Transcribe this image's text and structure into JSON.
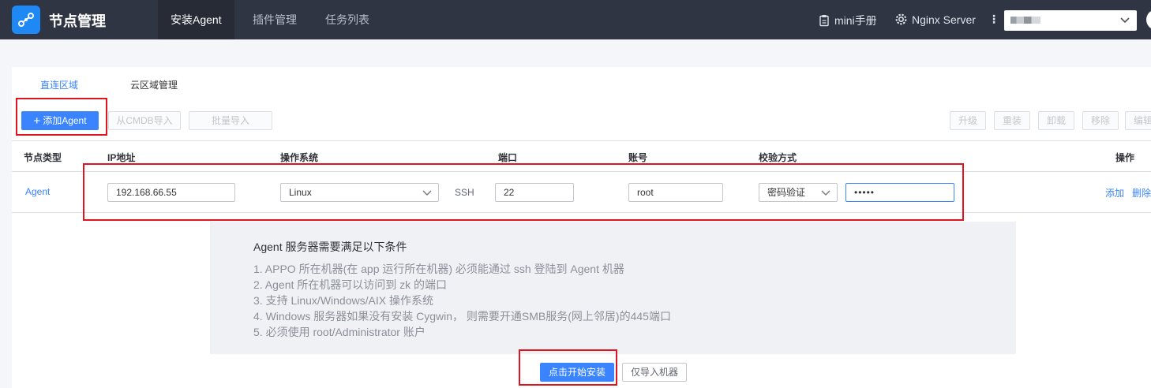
{
  "header": {
    "app_title": "节点管理",
    "tabs": [
      "安装Agent",
      "插件管理",
      "任务列表"
    ],
    "manual_label": "mini手册",
    "server_label": "Nginx Server",
    "more_glyph": "⋮"
  },
  "subtabs": [
    "直连区域",
    "云区域管理"
  ],
  "toolbar": {
    "add_agent": "添加Agent",
    "cmdb_import": "从CMDB导入",
    "batch_import": "批量导入",
    "right_buttons": [
      "升级",
      "重装",
      "卸载",
      "移除",
      "编辑"
    ]
  },
  "table": {
    "columns": [
      "节点类型",
      "IP地址",
      "操作系统",
      "端口",
      "账号",
      "校验方式",
      "操作"
    ],
    "row": {
      "node_type": "Agent",
      "ip": "192.168.66.55",
      "os": "Linux",
      "protocol": "SSH",
      "port": "22",
      "account": "root",
      "auth_method": "密码验证",
      "password_mask": "•••••",
      "actions": [
        "添加",
        "删除"
      ]
    }
  },
  "requirements": {
    "title": "Agent 服务器需要满足以下条件",
    "lines": [
      "1. APPO 所在机器(在 app 运行所在机器) 必须能通过 ssh 登陆到 Agent 机器",
      "2. Agent 所在机器可以访问到 zk 的端口",
      "3. 支持 Linux/Windows/AIX 操作系统",
      "4. Windows 服务器如果没有安装 Cygwin， 则需要开通SMB服务(网上邻居)的445端口",
      "5. 必须使用 root/Administrator 账户"
    ]
  },
  "footer": {
    "install": "点击开始安装",
    "import_only": "仅导入机器"
  },
  "colors": {
    "header_bg": "#2f3542",
    "accent": "#3a84ff",
    "highlight": "#e0141e"
  }
}
